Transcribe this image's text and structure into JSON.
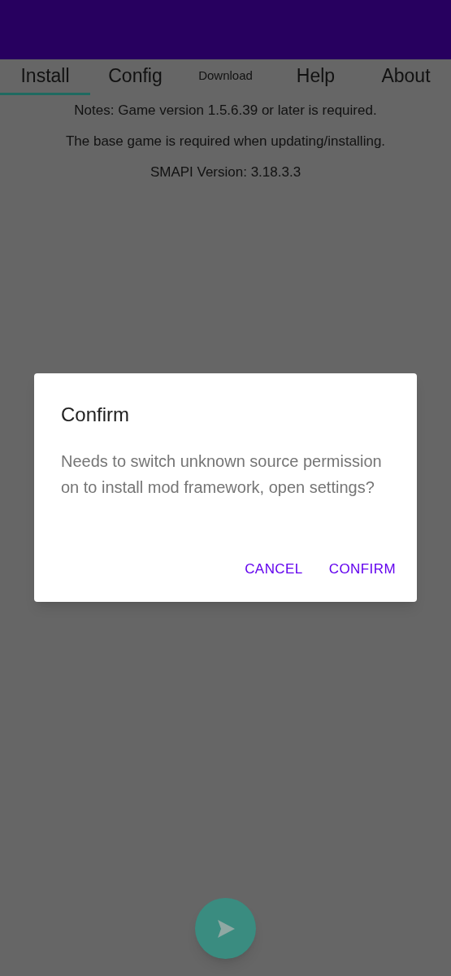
{
  "tabs": [
    {
      "label": "Install",
      "selected": true
    },
    {
      "label": "Config",
      "selected": false
    },
    {
      "label": "Download",
      "selected": false,
      "small": true
    },
    {
      "label": "Help",
      "selected": false
    },
    {
      "label": "About",
      "selected": false
    }
  ],
  "notes": [
    "Notes: Game version 1.5.6.39 or later is required.",
    "The base game is required when updating/installing.",
    "SMAPI Version: 3.18.3.3"
  ],
  "dialog": {
    "title": "Confirm",
    "message": "Needs to switch unknown source permission on to install mod framework, open settings?",
    "buttons": [
      "CANCEL",
      "CONFIRM"
    ]
  }
}
